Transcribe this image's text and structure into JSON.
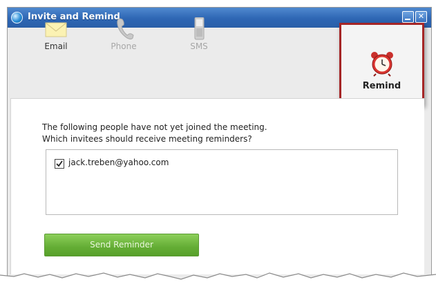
{
  "window": {
    "title": "Invite and Remind"
  },
  "tabs": [
    {
      "id": "email",
      "label": "Email",
      "icon": "envelope-icon",
      "enabled": true
    },
    {
      "id": "phone",
      "label": "Phone",
      "icon": "phone-icon",
      "enabled": false
    },
    {
      "id": "sms",
      "label": "SMS",
      "icon": "mobile-phone-icon",
      "enabled": false
    },
    {
      "id": "remind",
      "label": "Remind",
      "icon": "alarm-clock-icon",
      "enabled": true,
      "selected": true
    }
  ],
  "reminder": {
    "prompt_line1": "The following people have not yet joined the meeting.",
    "prompt_line2": "Which invitees should receive meeting reminders?",
    "invitees": [
      {
        "email": "jack.treben@yahoo.com",
        "checked": true
      }
    ],
    "send_button_label": "Send Reminder"
  },
  "colors": {
    "titlebar": "#2e66b4",
    "highlight_border": "#a52526",
    "send_button": "#64ad35"
  }
}
